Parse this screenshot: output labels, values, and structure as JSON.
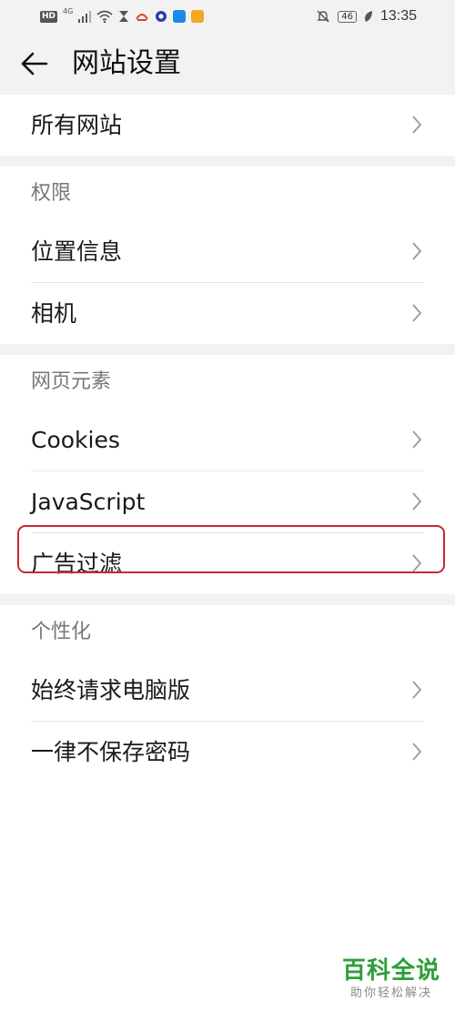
{
  "status_bar": {
    "left_badge": "HD",
    "signal_label": "4G",
    "battery": "46",
    "time": "13:35"
  },
  "title_bar": {
    "title": "网站设置",
    "back_icon": "arrow-left-icon"
  },
  "sections": [
    {
      "header": "",
      "items": [
        {
          "label": "所有网站"
        }
      ]
    },
    {
      "header": "权限",
      "items": [
        {
          "label": "位置信息"
        },
        {
          "label": "相机"
        }
      ]
    },
    {
      "header": "网页元素",
      "items": [
        {
          "label": "Cookies"
        },
        {
          "label": "JavaScript"
        },
        {
          "label": "广告过滤"
        }
      ]
    },
    {
      "header": "个性化",
      "items": [
        {
          "label": "始终请求电脑版"
        },
        {
          "label": "一律不保存密码"
        }
      ]
    }
  ],
  "watermark": {
    "main": "百科全说",
    "sub": "助你轻松解决"
  },
  "colors": {
    "highlight": "#c62a32",
    "watermark": "#2e9e3a",
    "background_gray": "#f2f2f2"
  }
}
